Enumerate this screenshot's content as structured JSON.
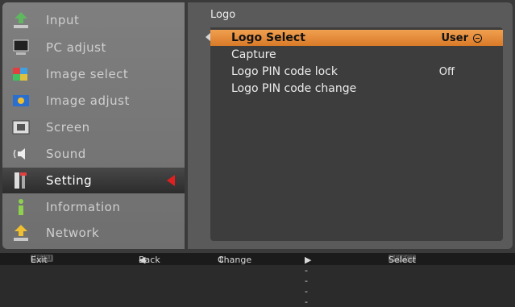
{
  "sidebar": {
    "items": [
      {
        "label": "Input",
        "icon": "input-icon"
      },
      {
        "label": "PC adjust",
        "icon": "pc-adjust-icon"
      },
      {
        "label": "Image select",
        "icon": "image-select-icon"
      },
      {
        "label": "Image adjust",
        "icon": "image-adjust-icon"
      },
      {
        "label": "Screen",
        "icon": "screen-icon"
      },
      {
        "label": "Sound",
        "icon": "sound-icon"
      },
      {
        "label": "Setting",
        "icon": "setting-icon"
      },
      {
        "label": "Information",
        "icon": "information-icon"
      },
      {
        "label": "Network",
        "icon": "network-icon"
      }
    ],
    "active_index": 6
  },
  "panel": {
    "title": "Logo",
    "rows": [
      {
        "label": "Logo Select",
        "value": "User"
      },
      {
        "label": "Capture",
        "value": ""
      },
      {
        "label": "Logo PIN code lock",
        "value": "Off"
      },
      {
        "label": "Logo PIN code change",
        "value": ""
      }
    ],
    "selected_index": 0
  },
  "footer": {
    "exit_key": "MENU",
    "exit": "Exit",
    "back": "Back",
    "change": "Change",
    "next": "-----",
    "select_key": "SELECT",
    "select": "Select"
  },
  "colors": {
    "highlight": "#e8913c",
    "active_arrow": "#e02020",
    "sidebar": "#7a7a7a",
    "panel": "#3d3d3d"
  }
}
